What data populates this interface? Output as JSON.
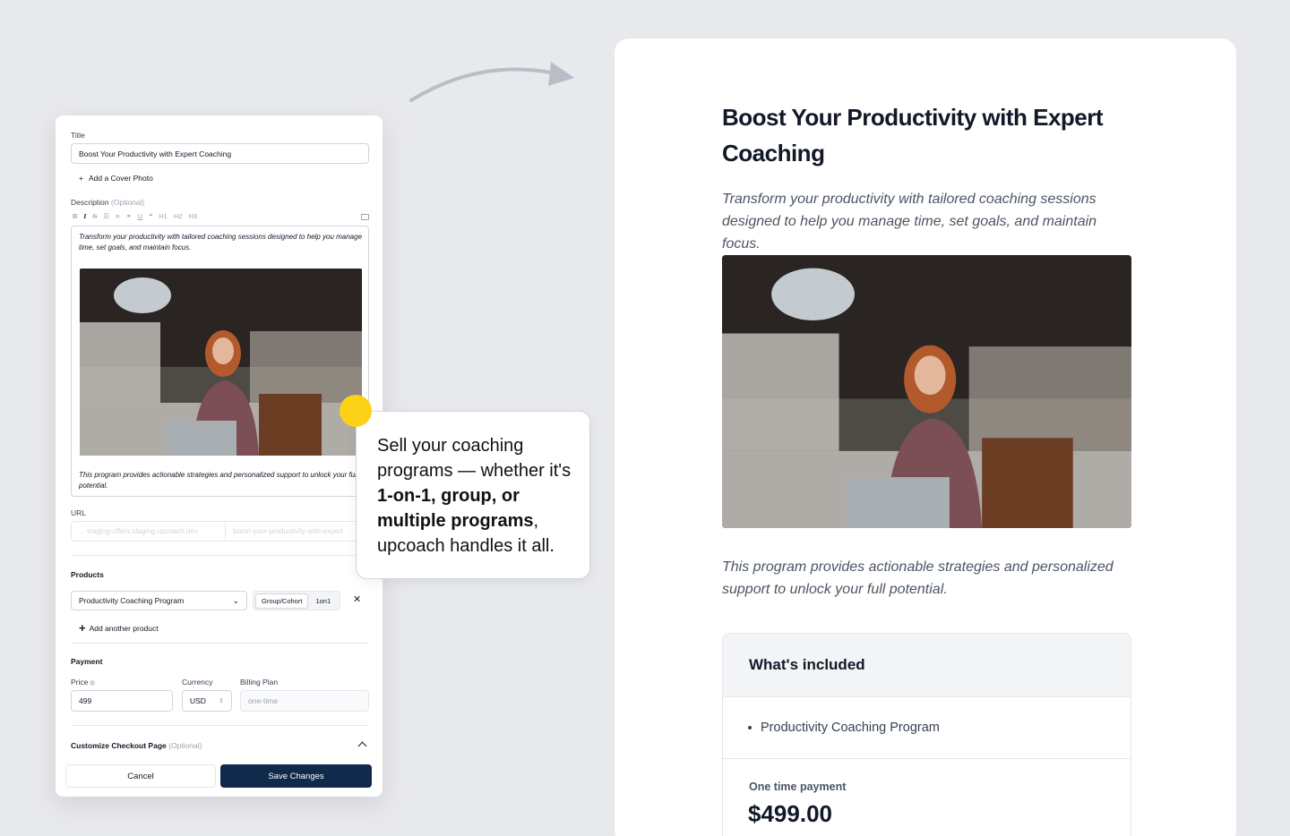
{
  "editor": {
    "title_label": "Title",
    "title_value": "Boost Your Productivity with Expert Coaching",
    "add_cover_label": "Add a Cover Photo",
    "description_label": "Description",
    "optional_label": "(Optional)",
    "toolbar": {
      "bold": "B",
      "italic": "I",
      "strike": "S",
      "underline": "U",
      "h1": "H1",
      "h2": "H2",
      "h3": "H3"
    },
    "description_text": "Transform your productivity with tailored coaching sessions designed to help you manage time, set goals, and maintain focus.",
    "description_footer": "This program provides actionable strategies and personalized support to unlock your full potential.",
    "url_label": "URL",
    "url_prefix": "... staging-offers.staging.upcoach.dev",
    "url_slug": "boost-your-productivity-with-expert",
    "products_label": "Products",
    "product_selected": "Productivity Coaching Program",
    "product_types": [
      "Group/Cohort",
      "1on1"
    ],
    "add_product_label": "Add another product",
    "payment_label": "Payment",
    "price_label": "Price",
    "price_value": "499",
    "currency_label": "Currency",
    "currency_value": "USD",
    "billing_label": "Billing Plan",
    "billing_value": "one-time",
    "customize_label": "Customize Checkout Page",
    "cancel_label": "Cancel",
    "save_label": "Save Changes"
  },
  "callout": {
    "text_1": "Sell your coaching programs — whether it's ",
    "text_bold": "1-on-1, group, or multiple programs",
    "text_2": ", upcoach handles it all."
  },
  "preview": {
    "title": "Boost Your Productivity with Expert Coaching",
    "description": "Transform your productivity with tailored coaching sessions designed to help you manage time, set goals, and maintain focus.",
    "description_footer": "This program provides actionable strategies and personalized support to unlock your full potential.",
    "included_heading": "What's included",
    "included_items": [
      "Productivity Coaching Program"
    ],
    "payment_label": "One time payment",
    "payment_amount": "$499.00"
  },
  "colors": {
    "primary_button": "#0f2a4a",
    "callout_dot": "#fcd116",
    "background": "#e8e9ec"
  }
}
